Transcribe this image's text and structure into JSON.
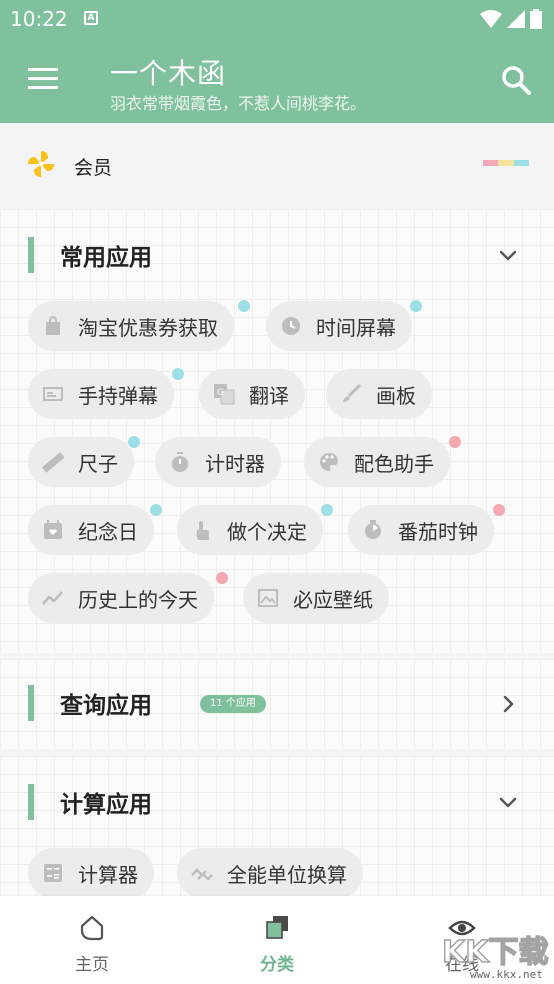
{
  "status_bar": {
    "time": "10:22",
    "notification_glyph": "A"
  },
  "header": {
    "title": "一个木函",
    "subtitle": "羽衣常带烟霞色，不惹人间桃李花。"
  },
  "member": {
    "label": "会员",
    "stripe_colors": [
      "#f4a8b8",
      "#f6e39b",
      "#9ddfe6"
    ]
  },
  "sections": {
    "common": {
      "title": "常用应用",
      "apps": [
        {
          "label": "淘宝优惠券获取",
          "icon": "shopping-bag-icon",
          "dot": "#9ddfe6"
        },
        {
          "label": "时间屏幕",
          "icon": "clock-icon",
          "dot": "#9ddfe6"
        },
        {
          "label": "手持弹幕",
          "icon": "danmaku-icon",
          "dot": "#9ddfe6"
        },
        {
          "label": "翻译",
          "icon": "translate-icon",
          "dot": ""
        },
        {
          "label": "画板",
          "icon": "brush-icon",
          "dot": ""
        },
        {
          "label": "尺子",
          "icon": "ruler-icon",
          "dot": "#9ddfe6"
        },
        {
          "label": "计时器",
          "icon": "stopwatch-icon",
          "dot": ""
        },
        {
          "label": "配色助手",
          "icon": "palette-icon",
          "dot": "#f6a8b0"
        },
        {
          "label": "纪念日",
          "icon": "calendar-icon",
          "dot": "#9ddfe6"
        },
        {
          "label": "做个决定",
          "icon": "tap-icon",
          "dot": "#9ddfe6"
        },
        {
          "label": "番茄时钟",
          "icon": "timer-icon",
          "dot": "#f6a8b0"
        },
        {
          "label": "历史上的今天",
          "icon": "trend-icon",
          "dot": "#f6a8b0"
        },
        {
          "label": "必应壁纸",
          "icon": "image-icon",
          "dot": ""
        }
      ]
    },
    "query": {
      "title": "查询应用",
      "count_badge": "11 个应用"
    },
    "calc": {
      "title": "计算应用",
      "apps": [
        {
          "label": "计算器",
          "icon": "calculator-icon"
        },
        {
          "label": "全能单位换算",
          "icon": "convert-icon"
        }
      ]
    }
  },
  "bottom_nav": {
    "items": [
      {
        "label": "主页",
        "icon": "home-icon"
      },
      {
        "label": "分类",
        "icon": "category-icon"
      },
      {
        "label": "在线",
        "icon": "eye-icon"
      }
    ]
  },
  "watermark": {
    "text": "www.kkx.net"
  },
  "colors": {
    "primary": "#80c19d",
    "chip_bg": "#ececec",
    "icon_grey": "#bdbdbd"
  }
}
